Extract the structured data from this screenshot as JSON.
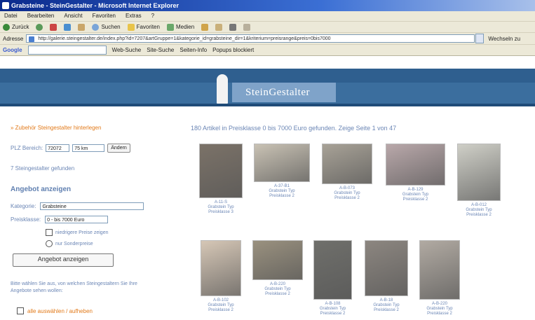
{
  "window": {
    "title": "Grabsteine - SteinGestalter - Microsoft Internet Explorer",
    "menu": [
      "Datei",
      "Bearbeiten",
      "Ansicht",
      "Favoriten",
      "Extras",
      "?"
    ],
    "nav": {
      "back": "Zurück",
      "search": "Suchen",
      "favorites": "Favoriten",
      "media": "Medien"
    },
    "address_label": "Adresse",
    "address_value": "http://galerie.steingestalter.de/index.php?id=7207&artGruppe=1&kategorie_id=grabsteine_dir=1&kriterium=preisrange&preis=0bis7000",
    "go_label": "Wechseln zu",
    "googlebar": {
      "logo": "Google",
      "web_search": "Web-Suche",
      "site_search": "Site-Suche",
      "page_info": "Seiten-Info",
      "popup": "Popups blockiert"
    }
  },
  "site": {
    "logo_text": "SteinGestalter"
  },
  "sidebar": {
    "top_link": "» Zubehör Steingestalter hinterlegen",
    "plz_label": "PLZ Bereich:",
    "plz_value": "72072",
    "radius_value": "75 km",
    "change_button": "Ändern",
    "found_text": "7 Steingestalter gefunden",
    "heading": "Angebot anzeigen",
    "category_label": "Kategorie:",
    "category_value": "Grabsteine",
    "price_label": "Preisklasse:",
    "price_value": "0 - bis 7000 Euro",
    "option_prices": "niedrigere Preise zeigen",
    "option_special": "nur Sonderpreise",
    "show_button": "Angebot anzeigen",
    "note": "Bitte wählen Sie aus, von welchen Steingestaltern Sie Ihre Angebote sehen wollen:",
    "bottom_link": "alle auswählen / aufheben"
  },
  "main": {
    "headline": "180 Artikel in Preisklasse 0 bis 7000 Euro gefunden. Zeige Seite 1 von 47",
    "items": [
      {
        "code": "A-11-S",
        "l1": "Grabstein Typ",
        "l2": "Preisklasse 3",
        "color": "#7b7268"
      },
      {
        "code": "A-37-B1",
        "l1": "Grabstein Typ",
        "l2": "Preisklasse 2",
        "color": "#c9c2b4"
      },
      {
        "code": "A-B-073",
        "l1": "Grabstein Typ",
        "l2": "Preisklasse 2",
        "color": "#a8a297"
      },
      {
        "code": "A-B-129",
        "l1": "Grabstein Typ",
        "l2": "Preisklasse 2",
        "color": "#b9a8aa"
      },
      {
        "code": "A-B-012",
        "l1": "Grabstein Typ",
        "l2": "Preisklasse 2",
        "color": "#cfcfc7"
      },
      {
        "code": "A-B-102",
        "l1": "Grabstein Typ",
        "l2": "Preisklasse 2",
        "color": "#d6c7b6"
      },
      {
        "code": "A-B-220",
        "l1": "Grabstein Typ",
        "l2": "Preisklasse 2",
        "color": "#9a917f"
      },
      {
        "code": "A-B-108",
        "l1": "Grabstein Typ",
        "l2": "Preisklasse 2",
        "color": "#6f6f6b"
      },
      {
        "code": "A-B-18",
        "l1": "Grabstein Typ",
        "l2": "Preisklasse 2",
        "color": "#8c8680"
      },
      {
        "code": "A-B-220",
        "l1": "Grabstein Typ",
        "l2": "Preisklasse 2",
        "color": "#b1aaa2"
      }
    ]
  }
}
